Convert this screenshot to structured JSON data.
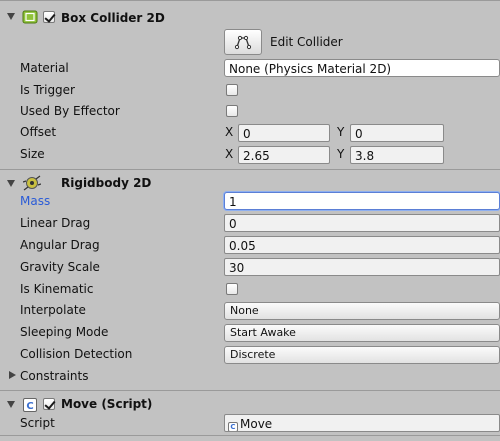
{
  "box_collider": {
    "title": "Box Collider 2D",
    "enabled": true,
    "edit_collider_label": "Edit Collider",
    "material": {
      "label": "Material",
      "value": "None (Physics Material 2D)"
    },
    "is_trigger": {
      "label": "Is Trigger",
      "checked": false
    },
    "used_by_effector": {
      "label": "Used By Effector",
      "checked": false
    },
    "offset": {
      "label": "Offset",
      "x_label": "X",
      "x": "0",
      "y_label": "Y",
      "y": "0"
    },
    "size": {
      "label": "Size",
      "x_label": "X",
      "x": "2.65",
      "y_label": "Y",
      "y": "3.8"
    }
  },
  "rigidbody": {
    "title": "Rigidbody 2D",
    "mass": {
      "label": "Mass",
      "value": "1"
    },
    "linear_drag": {
      "label": "Linear Drag",
      "value": "0"
    },
    "angular_drag": {
      "label": "Angular Drag",
      "value": "0.05"
    },
    "gravity_scale": {
      "label": "Gravity Scale",
      "value": "30"
    },
    "is_kinematic": {
      "label": "Is Kinematic",
      "checked": false
    },
    "interpolate": {
      "label": "Interpolate",
      "value": "None"
    },
    "sleeping_mode": {
      "label": "Sleeping Mode",
      "value": "Start Awake"
    },
    "collision_detection": {
      "label": "Collision Detection",
      "value": "Discrete"
    },
    "constraints": {
      "label": "Constraints"
    }
  },
  "move_script": {
    "title": "Move (Script)",
    "enabled": true,
    "script": {
      "label": "Script",
      "value": "Move"
    }
  },
  "colors": {
    "panel_bg": "#c2c2c2",
    "focused_label": "#2a5bd7",
    "focus_border": "#5b7fd6"
  },
  "icons": {
    "box_collider": "box-collider-icon",
    "rigidbody": "rigidbody-icon",
    "script": "script-icon",
    "edit_collider": "edit-collider-icon"
  }
}
